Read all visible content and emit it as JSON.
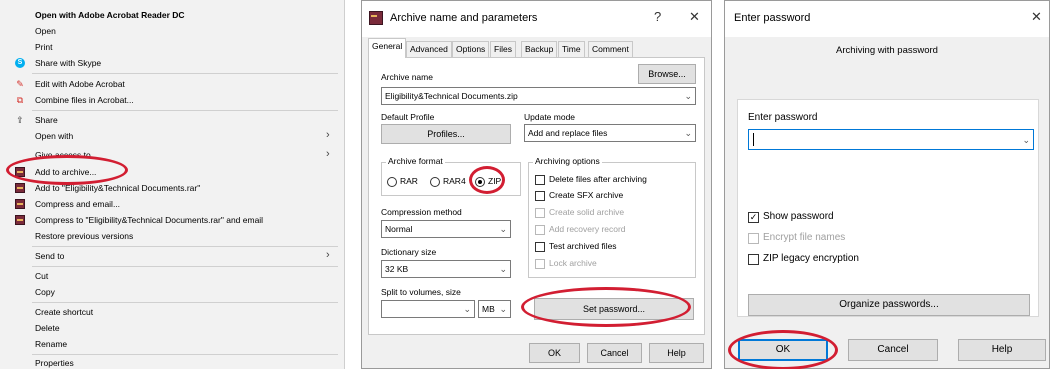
{
  "context_menu": {
    "items": [
      {
        "label": "Open with Adobe Acrobat Reader DC",
        "bold": true
      },
      {
        "label": "Open"
      },
      {
        "label": "Print"
      },
      {
        "label": "Share with Skype",
        "icon": "skype-icon"
      },
      {
        "label": "Edit with Adobe Acrobat",
        "icon": "acrobat-icon"
      },
      {
        "label": "Combine files in Acrobat...",
        "icon": "acrobat-combine-icon"
      },
      {
        "label": "Share",
        "icon": "share-icon"
      },
      {
        "label": "Open with",
        "submenu": true
      },
      {
        "label": "Give access to",
        "submenu": true
      },
      {
        "label": "Add to archive...",
        "icon": "winrar-icon"
      },
      {
        "label": "Add to \"Eligibility&Technical Documents.rar\"",
        "icon": "winrar-icon"
      },
      {
        "label": "Compress and email...",
        "icon": "winrar-icon"
      },
      {
        "label": "Compress to \"Eligibility&Technical Documents.rar\" and email",
        "icon": "winrar-icon"
      },
      {
        "label": "Restore previous versions"
      },
      {
        "label": "Send to",
        "submenu": true
      },
      {
        "label": "Cut"
      },
      {
        "label": "Copy"
      },
      {
        "label": "Create shortcut"
      },
      {
        "label": "Delete"
      },
      {
        "label": "Rename"
      },
      {
        "label": "Properties"
      }
    ],
    "submenu_arrow": "›"
  },
  "archive_dialog": {
    "title": "Archive name and parameters",
    "help_btn": "?",
    "close_btn": "✕",
    "tabs": [
      "General",
      "Advanced",
      "Options",
      "Files",
      "Backup",
      "Time",
      "Comment"
    ],
    "active_tab": "General",
    "archive_name_label": "Archive name",
    "browse_btn": "Browse...",
    "archive_name_value": "Eligibility&Technical Documents.zip",
    "default_profile_label": "Default Profile",
    "profiles_btn": "Profiles...",
    "update_mode_label": "Update mode",
    "update_mode_value": "Add and replace files",
    "archive_format": {
      "label": "Archive format",
      "options": [
        "RAR",
        "RAR4",
        "ZIP"
      ],
      "selected": "ZIP"
    },
    "archiving_options": {
      "label": "Archiving options",
      "items": [
        {
          "label": "Delete files after archiving",
          "checked": false,
          "disabled": false
        },
        {
          "label": "Create SFX archive",
          "checked": false,
          "disabled": false
        },
        {
          "label": "Create solid archive",
          "checked": false,
          "disabled": true
        },
        {
          "label": "Add recovery record",
          "checked": false,
          "disabled": true
        },
        {
          "label": "Test archived files",
          "checked": false,
          "disabled": false
        },
        {
          "label": "Lock archive",
          "checked": false,
          "disabled": true
        }
      ]
    },
    "compression_method_label": "Compression method",
    "compression_method_value": "Normal",
    "dictionary_size_label": "Dictionary size",
    "dictionary_size_value": "32 KB",
    "split_label": "Split to volumes, size",
    "split_value": "",
    "split_unit": "MB",
    "set_password_btn": "Set password...",
    "ok_btn": "OK",
    "cancel_btn": "Cancel",
    "help_btn_bottom": "Help"
  },
  "password_dialog": {
    "title": "Enter password",
    "close_btn": "✕",
    "heading": "Archiving with password",
    "enter_password_label": "Enter password",
    "password_value": "",
    "checkboxes": [
      {
        "label": "Show password",
        "checked": true,
        "disabled": false
      },
      {
        "label": "Encrypt file names",
        "checked": false,
        "disabled": true
      },
      {
        "label": "ZIP legacy encryption",
        "checked": false,
        "disabled": false
      }
    ],
    "organize_btn": "Organize passwords...",
    "ok_btn": "OK",
    "cancel_btn": "Cancel",
    "help_btn": "Help"
  },
  "colors": {
    "annotation_red": "#d21e32",
    "menu_bg": "#f2f2f2",
    "dialog_bg": "#f0f0f0",
    "focus_blue": "#0078d7"
  }
}
